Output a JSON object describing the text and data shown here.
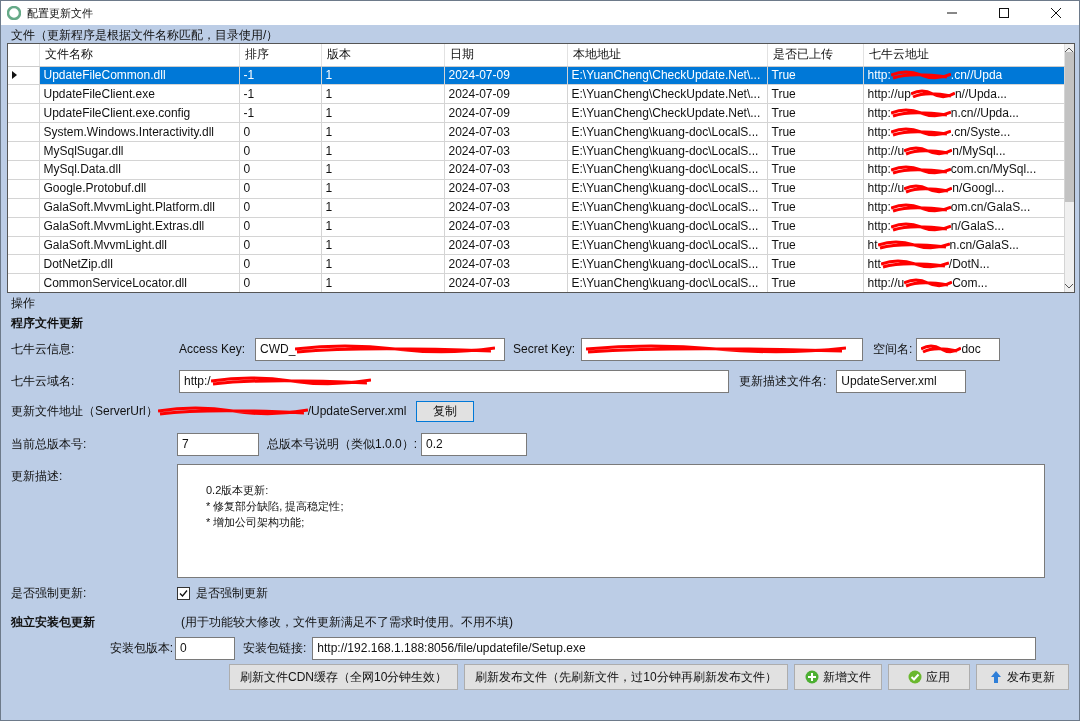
{
  "window": {
    "title": "配置更新文件"
  },
  "files_panel": {
    "caption": "文件（更新程序是根据文件名称匹配，目录使用/）"
  },
  "table": {
    "columns": [
      "文件名称",
      "排序",
      "版本",
      "日期",
      "本地地址",
      "是否已上传",
      "七牛云地址"
    ],
    "rows": [
      {
        "selected": true,
        "cells": [
          "UpdateFileCommon.dll",
          "-1",
          "1",
          "2024-07-09",
          "E:\\YuanCheng\\CheckUpdate.Net\\...",
          "True"
        ],
        "cloud_start": "http:",
        "cloud_end": ".cn//Upda"
      },
      {
        "selected": false,
        "cells": [
          "UpdateFileClient.exe",
          "-1",
          "1",
          "2024-07-09",
          "E:\\YuanCheng\\CheckUpdate.Net\\...",
          "True"
        ],
        "cloud_start": "http://up",
        "cloud_end": "n//Upda..."
      },
      {
        "selected": false,
        "cells": [
          "UpdateFileClient.exe.config",
          "-1",
          "1",
          "2024-07-09",
          "E:\\YuanCheng\\CheckUpdate.Net\\...",
          "True"
        ],
        "cloud_start": "http:",
        "cloud_end": "n.cn//Upda..."
      },
      {
        "selected": false,
        "cells": [
          "System.Windows.Interactivity.dll",
          "0",
          "1",
          "2024-07-03",
          "E:\\YuanCheng\\kuang-doc\\LocalS...",
          "True"
        ],
        "cloud_start": "http:",
        "cloud_end": ".cn/Syste..."
      },
      {
        "selected": false,
        "cells": [
          "MySqlSugar.dll",
          "0",
          "1",
          "2024-07-03",
          "E:\\YuanCheng\\kuang-doc\\LocalS...",
          "True"
        ],
        "cloud_start": "http://u",
        "cloud_end": "n/MySql..."
      },
      {
        "selected": false,
        "cells": [
          "MySql.Data.dll",
          "0",
          "1",
          "2024-07-03",
          "E:\\YuanCheng\\kuang-doc\\LocalS...",
          "True"
        ],
        "cloud_start": "http:",
        "cloud_end": "com.cn/MySql..."
      },
      {
        "selected": false,
        "cells": [
          "Google.Protobuf.dll",
          "0",
          "1",
          "2024-07-03",
          "E:\\YuanCheng\\kuang-doc\\LocalS...",
          "True"
        ],
        "cloud_start": "http://u",
        "cloud_end": "n/Googl..."
      },
      {
        "selected": false,
        "cells": [
          "GalaSoft.MvvmLight.Platform.dll",
          "0",
          "1",
          "2024-07-03",
          "E:\\YuanCheng\\kuang-doc\\LocalS...",
          "True"
        ],
        "cloud_start": "http:",
        "cloud_end": "om.cn/GalaS..."
      },
      {
        "selected": false,
        "cells": [
          "GalaSoft.MvvmLight.Extras.dll",
          "0",
          "1",
          "2024-07-03",
          "E:\\YuanCheng\\kuang-doc\\LocalS...",
          "True"
        ],
        "cloud_start": "http:",
        "cloud_end": "n/GalaS..."
      },
      {
        "selected": false,
        "cells": [
          "GalaSoft.MvvmLight.dll",
          "0",
          "1",
          "2024-07-03",
          "E:\\YuanCheng\\kuang-doc\\LocalS...",
          "True"
        ],
        "cloud_start": "ht",
        "cloud_end": "n.cn/GalaS..."
      },
      {
        "selected": false,
        "cells": [
          "DotNetZip.dll",
          "0",
          "1",
          "2024-07-03",
          "E:\\YuanCheng\\kuang-doc\\LocalS...",
          "True"
        ],
        "cloud_start": "htt",
        "cloud_end": "/DotN..."
      },
      {
        "selected": false,
        "cells": [
          "CommonServiceLocator.dll",
          "0",
          "1",
          "2024-07-03",
          "E:\\YuanCheng\\kuang-doc\\LocalS...",
          "True"
        ],
        "cloud_start": "http://u",
        "cloud_end": "Com..."
      }
    ]
  },
  "operations": {
    "caption": "操作",
    "section_title": "程序文件更新",
    "qiniu_info_label": "七牛云信息:",
    "access_key_label": "Access Key:",
    "access_key_start": "CWD_",
    "secret_key_label": "Secret Key:",
    "bucket_label": "空间名:",
    "bucket_end": "doc",
    "domain_label": "七牛云域名:",
    "domain_start": "http:/",
    "desc_file_label": "更新描述文件名:",
    "desc_file_value": "UpdateServer.xml",
    "server_url_label": "更新文件地址（ServerUrl）",
    "server_url_end": "/UpdateServer.xml",
    "copy_button": "复制",
    "version_label": "当前总版本号:",
    "version_value": "7",
    "version_note_label": "总版本号说明（类似1.0.0）:",
    "version_note_value": "0.2",
    "description_label": "更新描述:",
    "description_lines": [
      "0.2版本更新:",
      "* 修复部分缺陷, 提高稳定性;",
      "* 增加公司架构功能;"
    ],
    "force_label": "是否强制更新:",
    "force_checkbox": {
      "label": "是否强制更新",
      "checked": true
    }
  },
  "installer": {
    "section_title": "独立安装包更新",
    "hint": "(用于功能较大修改，文件更新满足不了需求时使用。不用不填)",
    "version_label": "安装包版本:",
    "version_value": "0",
    "link_label": "安装包链接:",
    "link_value": "http://192.168.1.188:8056/file/updatefile/Setup.exe"
  },
  "buttons": [
    {
      "kind": "plain",
      "label": "刷新文件CDN缓存（全网10分钟生效）"
    },
    {
      "kind": "plain",
      "label": "刷新发布文件（先刷新文件，过10分钟再刷新发布文件）"
    },
    {
      "kind": "add",
      "label": "新增文件"
    },
    {
      "kind": "apply",
      "label": "应用"
    },
    {
      "kind": "publish",
      "label": "发布更新"
    }
  ]
}
